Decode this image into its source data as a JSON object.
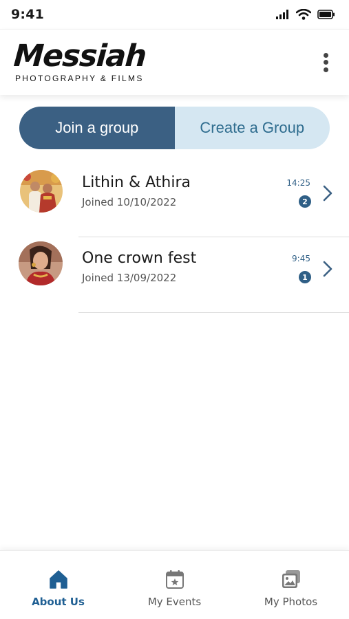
{
  "status_bar": {
    "time": "9:41"
  },
  "header": {
    "logo_title": "Messiah",
    "logo_subtitle": "PHOTOGRAPHY & FILMS"
  },
  "tabs": {
    "join_label": "Join a group",
    "create_label": "Create a Group",
    "active": "join"
  },
  "groups": [
    {
      "name": "Lithin & Athira",
      "joined": "Joined 10/10/2022",
      "time": "14:25",
      "unread": "2"
    },
    {
      "name": "One crown fest",
      "joined": "Joined 13/09/2022",
      "time": "9:45",
      "unread": "1"
    }
  ],
  "bottom_nav": {
    "items": [
      {
        "label": "About Us",
        "icon": "home-icon",
        "active": true
      },
      {
        "label": "My Events",
        "icon": "calendar-icon",
        "active": false
      },
      {
        "label": "My Photos",
        "icon": "photos-icon",
        "active": false
      }
    ]
  },
  "colors": {
    "primary": "#3b6083",
    "primary_light": "#d5e7f2",
    "accent": "#2f5f86",
    "nav_active": "#1f5f93"
  }
}
